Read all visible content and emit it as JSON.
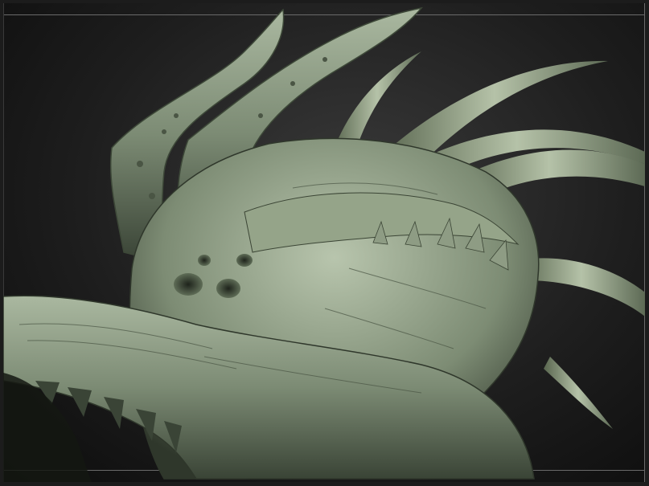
{
  "viewport": {
    "model_subject": "sculpted-creature-head",
    "colors": {
      "background_dark": "#0c0c0c",
      "background_light": "#3a3a3a",
      "material_base": "#7c8b74",
      "material_light": "#b9c6ad",
      "material_shadow": "#2f372b",
      "guide_line": "#6a6a6a"
    }
  }
}
